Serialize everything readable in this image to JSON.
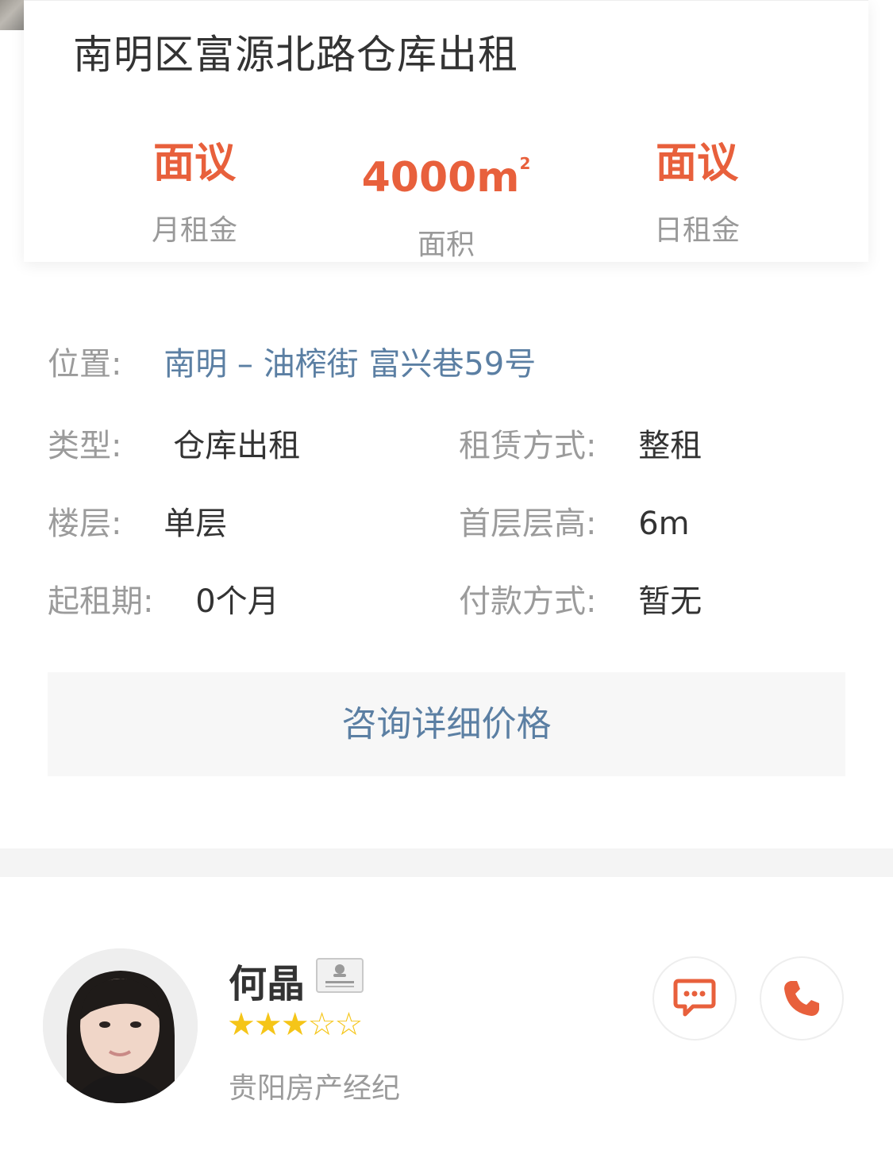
{
  "listing": {
    "title": "南明区富源北路仓库出租",
    "stats": [
      {
        "value": "面议",
        "label": "月租金"
      },
      {
        "value": "4000m",
        "sup": "2",
        "label": "面积"
      },
      {
        "value": "面议",
        "label": "日租金"
      }
    ]
  },
  "details": {
    "location_label": "位置:",
    "location_value": "南明 – 油榨街 富兴巷59号",
    "type_label": "类型:",
    "type_value": "仓库出租",
    "lease_label": "租赁方式:",
    "lease_value": "整租",
    "floor_label": "楼层:",
    "floor_value": "单层",
    "height_label": "首层层高:",
    "height_value": "6m",
    "min_period_label": "起租期:",
    "min_period_value": "0个月",
    "payment_label": "付款方式:",
    "payment_value": "暂无"
  },
  "consult_button": "咨询详细价格",
  "agent": {
    "name": "何晶",
    "rating": 3,
    "rating_max": 5,
    "title": "贵阳房产经纪",
    "verified_icon": "id-card-icon",
    "chat_icon": "chat-icon",
    "call_icon": "phone-icon"
  },
  "colors": {
    "accent": "#e8603c",
    "link": "#5b7fa3",
    "star": "#f5c518"
  }
}
